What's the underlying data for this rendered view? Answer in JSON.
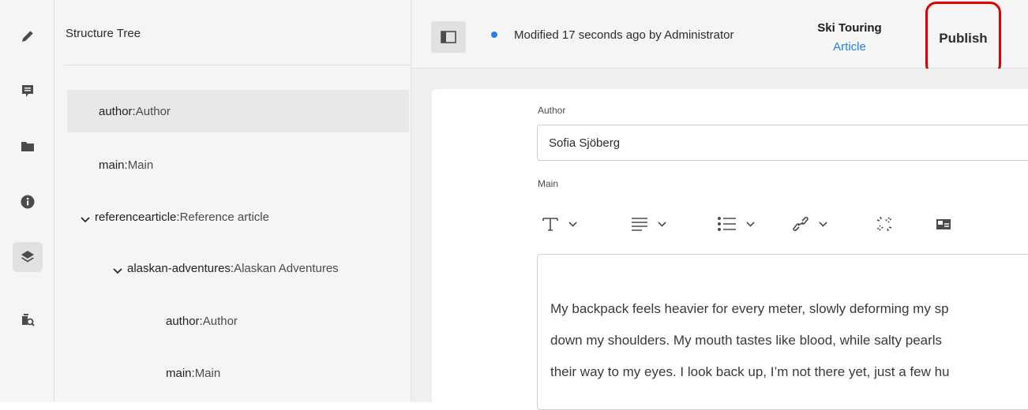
{
  "rail": {
    "items": [
      {
        "icon": "pencil-icon"
      },
      {
        "icon": "comment-icon"
      },
      {
        "icon": "folder-icon"
      },
      {
        "icon": "info-icon"
      },
      {
        "icon": "layers-icon",
        "active": true
      },
      {
        "icon": "search-assets-icon"
      }
    ]
  },
  "tree": {
    "title": "Structure Tree",
    "items": [
      {
        "key": "author",
        "sep": ": ",
        "value": "Author"
      },
      {
        "key": "main",
        "sep": ": ",
        "value": "Main"
      },
      {
        "key": "referencearticle",
        "sep": ": ",
        "value": "Reference article"
      },
      {
        "key": "alaskan-adventures",
        "sep": ": ",
        "value": "Alaskan Adventures"
      },
      {
        "key": "author",
        "sep": ": ",
        "value": "Author"
      },
      {
        "key": "main",
        "sep": ": ",
        "value": "Main"
      }
    ]
  },
  "header": {
    "status": "Modified 17 seconds ago by Administrator",
    "doc_title": "Ski Touring",
    "doc_type": "Article",
    "publish_label": "Publish",
    "status_color": "#2680eb",
    "highlight_color": "#e00000"
  },
  "editor": {
    "author_label": "Author",
    "author_value": "Sofia Sjöberg",
    "main_label": "Main",
    "toolbar": [
      "text-style-icon",
      "align-icon",
      "list-icon",
      "link-icon",
      "unlink-icon",
      "image-icon"
    ],
    "lines": [
      "My backpack feels heavier for every meter, slowly deforming my sp",
      "down my shoulders. My mouth tastes like blood, while salty pearls",
      "their way to my eyes. I look back up, I’m not there yet, just a few hu"
    ]
  }
}
